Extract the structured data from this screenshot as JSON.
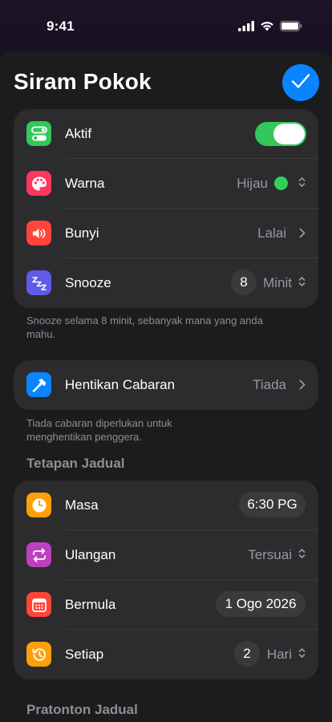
{
  "status_bar": {
    "time": "9:41"
  },
  "title": "Siram Pokok",
  "group_main": {
    "aktif": {
      "label": "Aktif",
      "on": true
    },
    "warna": {
      "label": "Warna",
      "value": "Hijau",
      "color": "#30d158"
    },
    "bunyi": {
      "label": "Bunyi",
      "value": "Lalai"
    },
    "snooze": {
      "label": "Snooze",
      "count": "8",
      "unit": "Minit"
    }
  },
  "snooze_note": "Snooze selama 8 minit, sebanyak mana yang anda mahu.",
  "group_stop": {
    "label": "Hentikan Cabaran",
    "value": "Tiada"
  },
  "stop_note": "Tiada cabaran diperlukan untuk menghentikan penggera.",
  "schedule_header": "Tetapan Jadual",
  "group_schedule": {
    "masa": {
      "label": "Masa",
      "value": "6:30 PG"
    },
    "ulangan": {
      "label": "Ulangan",
      "value": "Tersuai"
    },
    "bermula": {
      "label": "Bermula",
      "value": "1 Ogo 2026"
    },
    "setiap": {
      "label": "Setiap",
      "count": "2",
      "unit": "Hari"
    }
  },
  "preview_header": "Pratonton Jadual",
  "colors": {
    "accent": "#0a84ff",
    "toggle_on": "#34c759",
    "icon_aktif": "#34c759",
    "icon_warna": "#ff375f",
    "icon_bunyi": "#ff453a",
    "icon_snooze": "#5e5ce6",
    "icon_hentikan": "#0a84ff",
    "icon_masa": "#ff9f0a",
    "icon_ulangan": "#bf40bf",
    "icon_bermula": "#ff453a",
    "icon_setiap": "#ff9f0a"
  }
}
